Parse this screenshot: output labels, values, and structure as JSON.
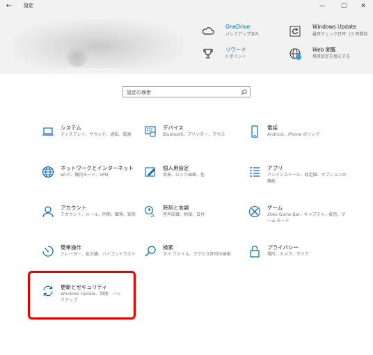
{
  "titlebar": {
    "back_glyph": "←",
    "title": "設定",
    "minimize": "—",
    "maximize": "☐",
    "close": "✕"
  },
  "header": {
    "onedrive": {
      "title": "OneDrive",
      "subtitle": "バックアップ済み",
      "icon": "cloud-icon"
    },
    "rewards": {
      "title": "リワード",
      "subtitle": "0 ポイント",
      "icon": "trophy-icon"
    },
    "windows_update": {
      "title": "Windows Update",
      "subtitle": "最終チェック日時: 15 時間前",
      "icon": "refresh-icon"
    },
    "web_browsing": {
      "title": "Web 閲覧",
      "subtitle": "推奨設定を復元する",
      "icon": "globe-icon"
    }
  },
  "search": {
    "placeholder": "設定の検索"
  },
  "accent_color": "#0067c0",
  "tiles": [
    {
      "title": "システム",
      "subtitle": "ディスプレイ、サウンド、通知、電源",
      "icon": "laptop-icon"
    },
    {
      "title": "デバイス",
      "subtitle": "Bluetooth、プリンター、マウス",
      "icon": "keyboard-icon"
    },
    {
      "title": "電話",
      "subtitle": "Android、iPhone のリンク",
      "icon": "phone-icon"
    },
    {
      "title": "ネットワークとインターネット",
      "subtitle": "Wi-Fi、機内モード、VPN",
      "icon": "globe-icon"
    },
    {
      "title": "個人用設定",
      "subtitle": "背景、ロック画面、色",
      "icon": "paint-icon"
    },
    {
      "title": "アプリ",
      "subtitle": "アンインストール、既定値、オプションの機能",
      "icon": "apps-list-icon"
    },
    {
      "title": "アカウント",
      "subtitle": "アカウント、メール、同期、職場、家族",
      "icon": "person-icon"
    },
    {
      "title": "時刻と言語",
      "subtitle": "音声認識、地域、日付",
      "icon": "time-language-icon"
    },
    {
      "title": "ゲーム",
      "subtitle": "Xbox Game Bar、キャプチャ、配信、ゲーム モード",
      "icon": "xbox-icon"
    },
    {
      "title": "簡単操作",
      "subtitle": "ナレーター、拡大鏡、ハイコントラスト",
      "icon": "ease-of-access-icon"
    },
    {
      "title": "検索",
      "subtitle": "マイ ファイル、アクセス許可の検索",
      "icon": "search-icon"
    },
    {
      "title": "プライバシー",
      "subtitle": "場所、カメラ、マイク",
      "icon": "lock-icon"
    },
    {
      "title": "更新とセキュリティ",
      "subtitle": "Windows Update、回復、バックアップ",
      "icon": "sync-icon"
    }
  ],
  "highlighted_tile": "更新とセキュリティ"
}
